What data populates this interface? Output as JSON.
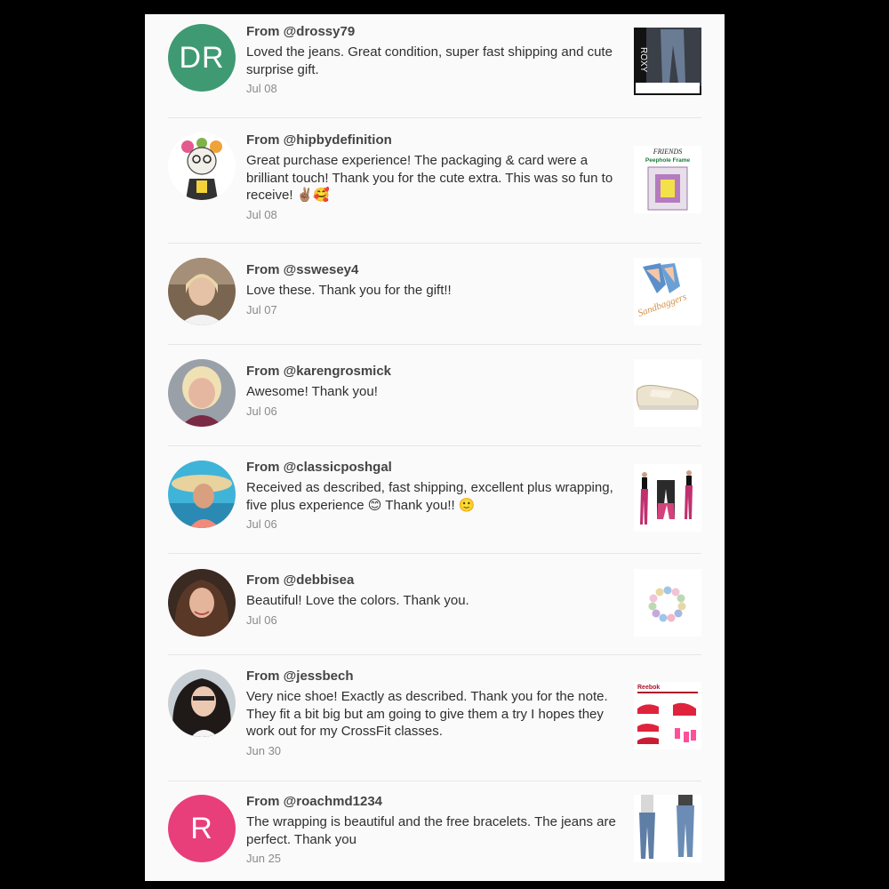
{
  "colors": {
    "page_bg": "#000000",
    "panel_bg": "#fbfafa",
    "avatar_green": "#3f9a73",
    "avatar_pink": "#e83e7a"
  },
  "reviews": [
    {
      "from": "From @drossy79",
      "message": "Loved the jeans. Great condition, super fast shipping and cute surprise gift.",
      "date": "Jul 08",
      "avatar_initials": "DR",
      "thumb_icon": "jeans-product-photo",
      "thumb_text": "ROXY"
    },
    {
      "from": "From @hipbydefinition",
      "message": "Great purchase experience! The packaging & card were a brilliant touch! Thank you for the cute extra. This was so fun to receive! ✌🏽🥰",
      "date": "Jul 08",
      "avatar_icon": "illustrated-avatar",
      "thumb_icon": "photo-frame-product-photo",
      "thumb_text_1": "FRIENDS",
      "thumb_text_2": "Peephole Frame"
    },
    {
      "from": "From @sswesey4",
      "message": "Love these. Thank you for the gift!!",
      "date": "Jul 07",
      "avatar_icon": "user-photo",
      "thumb_icon": "shoes-product-photo",
      "thumb_text": "Sandbaggers"
    },
    {
      "from": "From @karengrosmick",
      "message": "Awesome! Thank you!",
      "date": "Jul 06",
      "avatar_icon": "user-photo",
      "thumb_icon": "shoe-product-photo"
    },
    {
      "from": "From @classicposhgal",
      "message": "Received as described, fast shipping, excellent plus wrapping, five plus experience 😊 Thank you!! 🙂",
      "date": "Jul 06",
      "avatar_icon": "user-photo",
      "thumb_icon": "leggings-product-photo"
    },
    {
      "from": "From @debbisea",
      "message": "Beautiful! Love the colors. Thank you.",
      "date": "Jul 06",
      "avatar_icon": "user-photo",
      "thumb_icon": "bracelet-product-photo"
    },
    {
      "from": "From @jessbech",
      "message": "Very nice shoe! Exactly as described. Thank you for the note. They fit a bit big but am going to give them a try I hopes they work out for my CrossFit classes.",
      "date": "Jun 30",
      "avatar_icon": "user-photo",
      "thumb_icon": "sneakers-product-photo",
      "thumb_text": "Reebok"
    },
    {
      "from": "From @roachmd1234",
      "message": "The wrapping is beautiful and the free bracelets. The jeans are perfect. Thank you",
      "date": "Jun 25",
      "avatar_initials": "R",
      "thumb_icon": "jeans-product-photo"
    }
  ]
}
